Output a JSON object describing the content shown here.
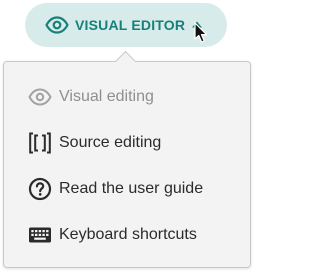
{
  "mode_button": {
    "label": "VISUAL EDITOR",
    "icon": "eye-icon",
    "caret_icon": "caret-up-icon",
    "accent_color": "#16807a",
    "background_color": "#d7ecea"
  },
  "menu": {
    "items": [
      {
        "label": "Visual editing",
        "icon": "eye-icon",
        "disabled": true
      },
      {
        "label": "Source editing",
        "icon": "source-brackets-icon",
        "disabled": false
      },
      {
        "label": "Read the user guide",
        "icon": "help-circle-icon",
        "disabled": false
      },
      {
        "label": "Keyboard shortcuts",
        "icon": "keyboard-icon",
        "disabled": false
      }
    ]
  }
}
